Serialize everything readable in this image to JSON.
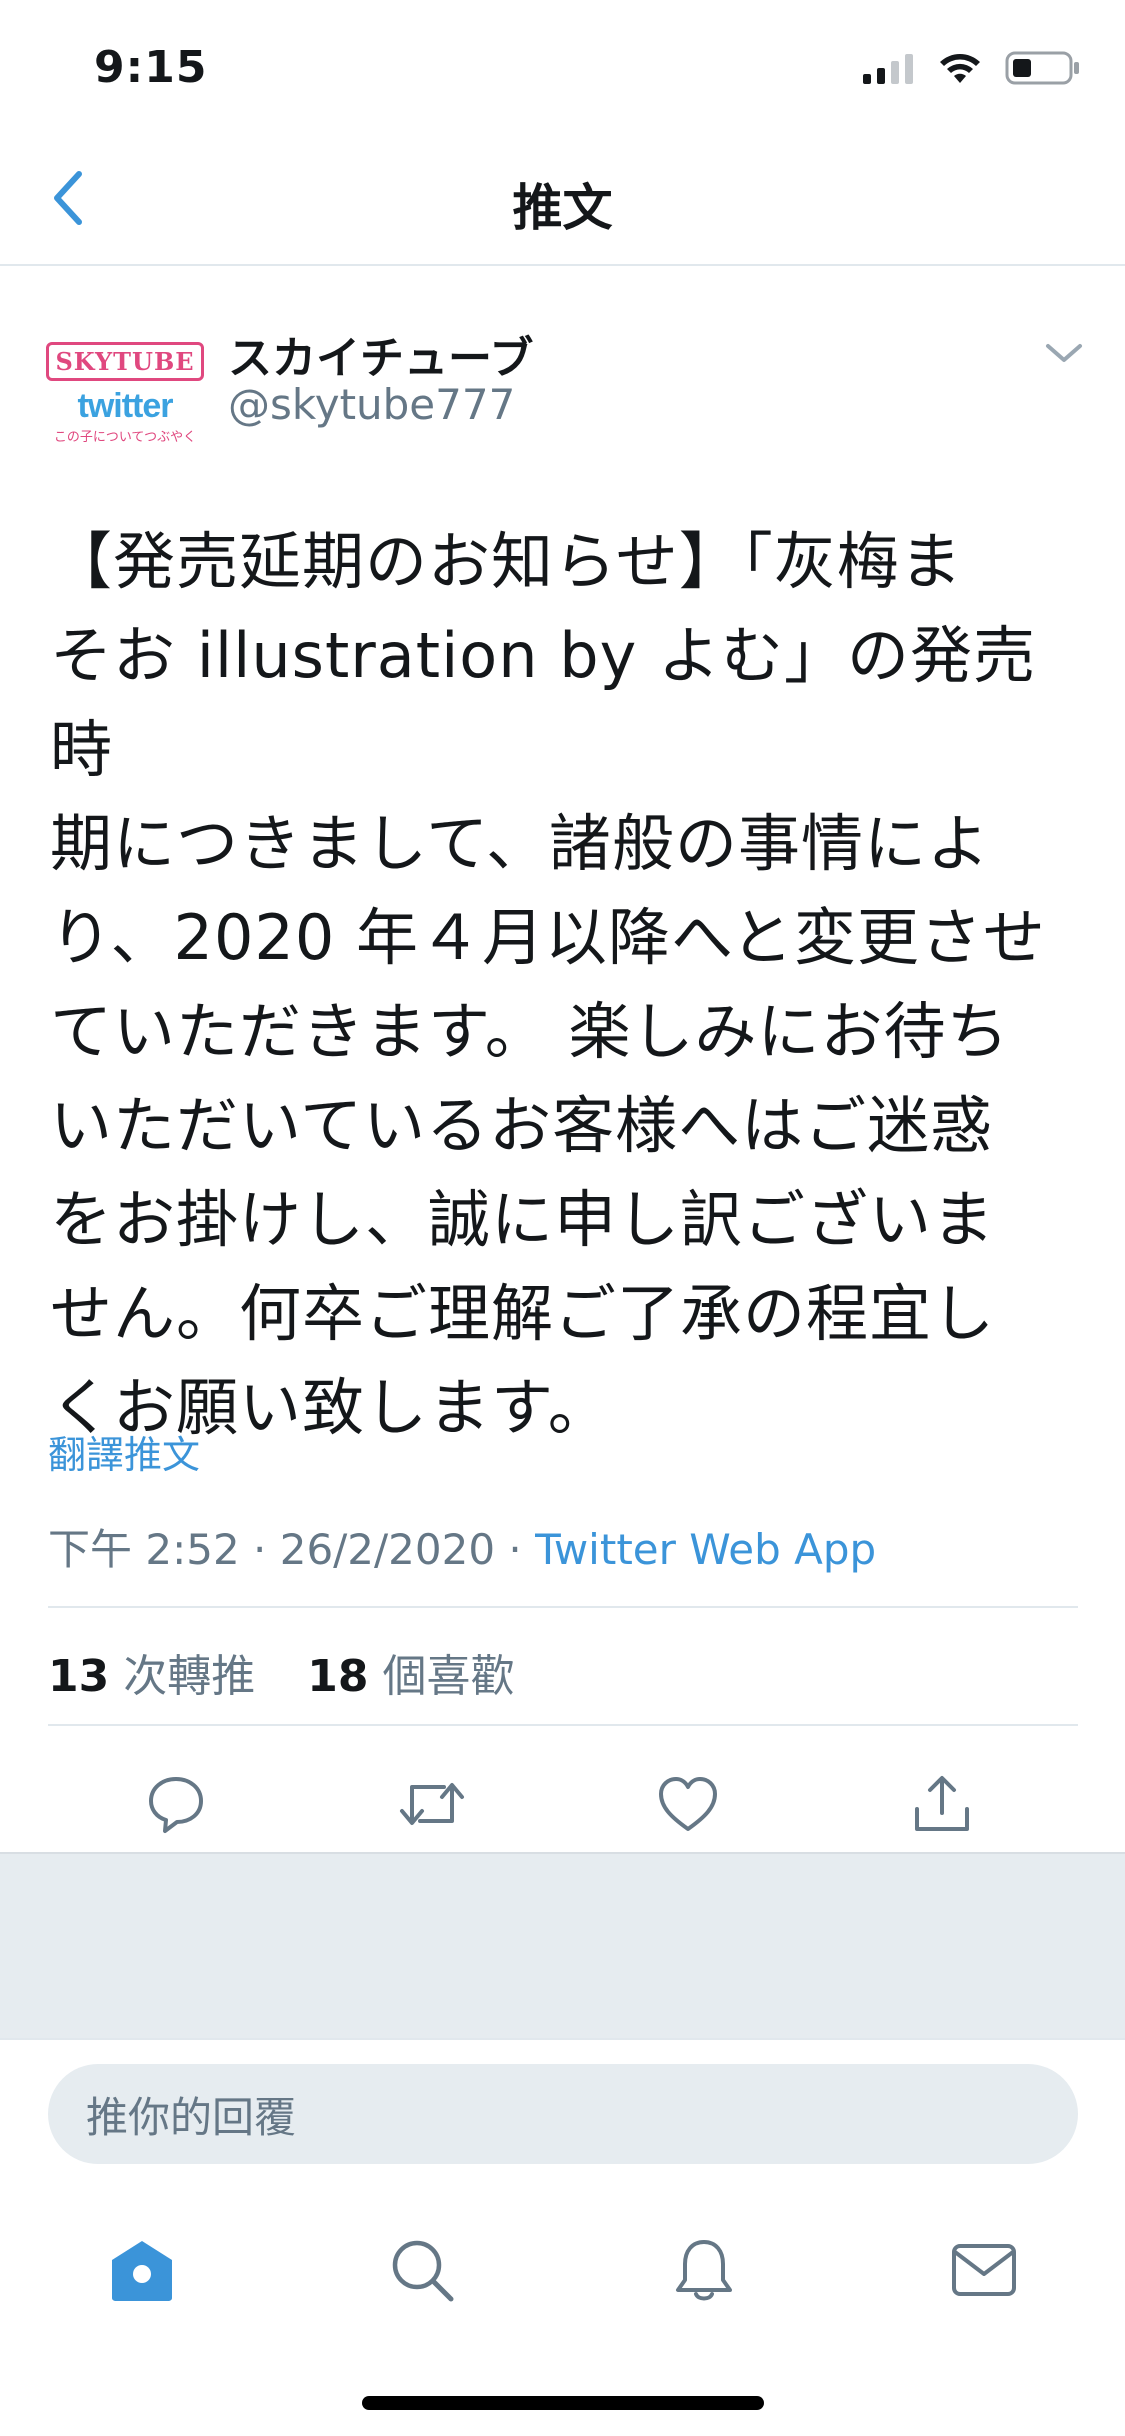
{
  "status_bar": {
    "time": "9:15"
  },
  "header": {
    "title": "推文"
  },
  "tweet": {
    "avatar": {
      "logo_top": "SKYTUBE",
      "logo_bottom": "twitter",
      "logo_sub": "この子についてつぶやく"
    },
    "display_name": "スカイチューブ",
    "handle": "@skytube777",
    "text_lines": [
      "【発売延期のお知らせ】「灰梅ま",
      "そお illustration by よむ」の発売時",
      "期につきまして、諸般の事情によ",
      "り、2020 年４月以降へと変更させ",
      "ていただきます。 楽しみにお待ち",
      "いただいているお客様へはご迷惑",
      "をお掛けし、誠に申し訳ございま",
      "せん。何卒ご理解ご了承の程宜し",
      "くお願い致します。"
    ],
    "translate_label": "翻譯推文",
    "timestamp": "下午 2:52 · 26/2/2020 · ",
    "source": "Twitter Web App",
    "retweet_count": "13",
    "retweet_label": " 次轉推",
    "like_count": "18",
    "like_label": " 個喜歡"
  },
  "reply": {
    "placeholder": "推你的回覆"
  },
  "colors": {
    "accent": "#3b94d9",
    "muted": "#657786",
    "divider": "#e1e8ed",
    "gray_panel": "#e6ecf0"
  },
  "icons": {
    "status": [
      "signal-icon",
      "wifi-icon",
      "battery-icon"
    ],
    "nav": [
      "back-chevron-icon",
      "chevron-down-icon"
    ],
    "actions": [
      "reply-icon",
      "retweet-icon",
      "like-icon",
      "share-icon"
    ],
    "tabs": [
      "home-icon",
      "search-icon",
      "notifications-icon",
      "messages-icon"
    ]
  }
}
